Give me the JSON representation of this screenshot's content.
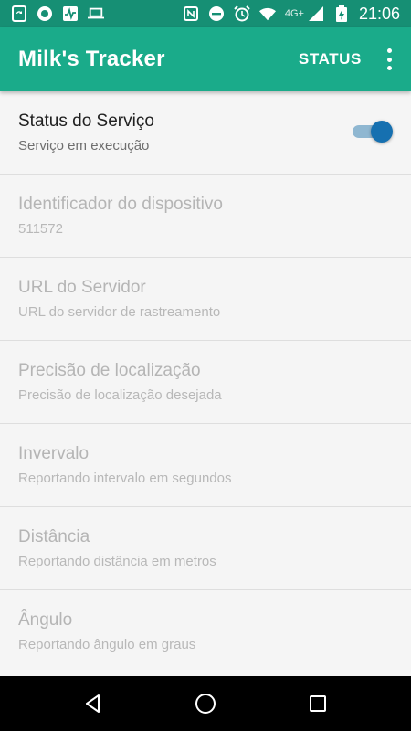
{
  "status_bar": {
    "time": "21:06",
    "network": "4G+",
    "left_icons": [
      "sync-icon",
      "record-icon",
      "activity-icon",
      "laptop-icon"
    ],
    "right_icons": [
      "nfc-icon",
      "do-not-disturb-icon",
      "alarm-icon",
      "wifi-icon",
      "signal-icon",
      "battery-charging-icon"
    ]
  },
  "app_bar": {
    "title": "Milk's Tracker",
    "status_label": "STATUS",
    "overflow_icon": "more-vert-icon"
  },
  "preferences": [
    {
      "title": "Status do Serviço",
      "summary": "Serviço em execução",
      "enabled": true,
      "has_switch": true,
      "switch_on": true
    },
    {
      "title": "Identificador do dispositivo",
      "summary": "511572",
      "enabled": false
    },
    {
      "title": "URL do Servidor",
      "summary": "URL do servidor de rastreamento",
      "enabled": false
    },
    {
      "title": "Precisão de localização",
      "summary": "Precisão de localização desejada",
      "enabled": false
    },
    {
      "title": "Invervalo",
      "summary": "Reportando intervalo em segundos",
      "enabled": false
    },
    {
      "title": "Distância",
      "summary": "Reportando distância em metros",
      "enabled": false
    },
    {
      "title": "Ângulo",
      "summary": "Reportando ângulo em graus",
      "enabled": false
    }
  ],
  "nav_bar": {
    "buttons": [
      "back-icon",
      "home-icon",
      "recents-icon"
    ]
  },
  "colors": {
    "status_bar": "#168f74",
    "app_bar": "#1aab8a",
    "switch_thumb": "#1670b0",
    "switch_track": "#8fb7d1"
  }
}
